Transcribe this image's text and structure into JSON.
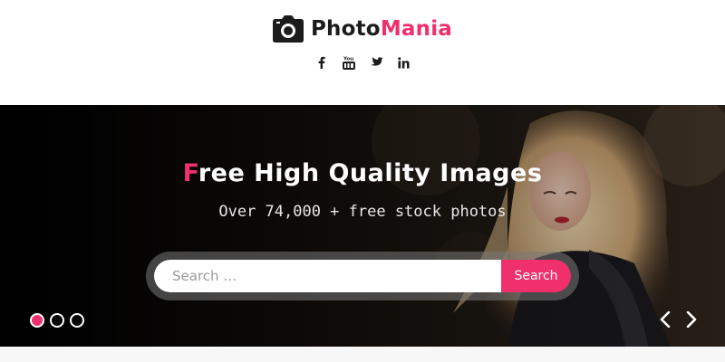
{
  "site": {
    "logo_icon": "camera-icon",
    "logo_part1": "Photo",
    "logo_part2": "Mania",
    "colors": {
      "accent": "#f0306d",
      "dark": "#1c1c1c"
    }
  },
  "social": [
    {
      "icon": "facebook-icon"
    },
    {
      "icon": "youtube-icon"
    },
    {
      "icon": "twitter-icon"
    },
    {
      "icon": "linkedin-icon"
    }
  ],
  "hero": {
    "title_first_letter": "F",
    "title_rest": "ree High Quality Images",
    "subtitle": "Over 74,000 + free stock photos",
    "search": {
      "placeholder": "Search …",
      "value": "",
      "button_label": "Search"
    },
    "slider": {
      "slide_count": 3,
      "active_index": 0,
      "prev_icon": "chevron-left-icon",
      "next_icon": "chevron-right-icon"
    }
  }
}
